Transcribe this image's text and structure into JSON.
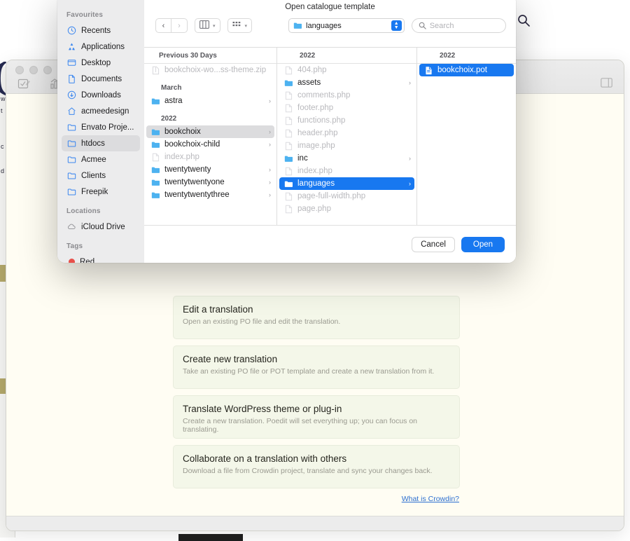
{
  "desktop": {
    "search_icon": "search-icon",
    "sliver_text": "w\nt\n\nc\n\nd"
  },
  "poedit_window": {
    "toolbar": {
      "traffic_lights": [
        "close",
        "minimize",
        "zoom"
      ],
      "icons": [
        "new-translation-icon",
        "statistics-icon"
      ],
      "sidebar_toggle_icon": "sidebar-toggle-icon"
    },
    "welcome": {
      "cards": [
        {
          "title": "Edit a translation",
          "subtitle": "Open an existing PO file and edit the translation."
        },
        {
          "title": "Create new translation",
          "subtitle": "Take an existing PO file or POT template and create a new translation from it."
        },
        {
          "title": "Translate WordPress theme or plug-in",
          "subtitle": "Create a new translation. Poedit will set everything up; you can focus on translating."
        },
        {
          "title": "Collaborate on a translation with others",
          "subtitle": "Download a file from Crowdin project, translate and sync your changes back."
        }
      ],
      "crowdin_link": "What is Crowdin?"
    }
  },
  "dialog": {
    "title": "Open catalogue template",
    "toolbar": {
      "back_label": "‹",
      "forward_label": "›",
      "view_icon": "column-view-icon",
      "view_chevron": "▾",
      "group_icon": "grid-view-icon",
      "group_chevron": "▾",
      "path_value": "languages",
      "path_icon": "folder-icon",
      "stepper_icon": "stepper-updown-icon",
      "search_icon": "search-icon",
      "search_value": "",
      "search_placeholder": "Search"
    },
    "sidebar": {
      "sections": [
        {
          "header": "Favourites",
          "items": [
            {
              "label": "Recents",
              "icon": "clock-icon",
              "selected": false
            },
            {
              "label": "Applications",
              "icon": "applications-icon",
              "selected": false
            },
            {
              "label": "Desktop",
              "icon": "desktop-icon",
              "selected": false
            },
            {
              "label": "Documents",
              "icon": "document-icon",
              "selected": false
            },
            {
              "label": "Downloads",
              "icon": "download-icon",
              "selected": false
            },
            {
              "label": "acmeedesign",
              "icon": "home-icon",
              "selected": false
            },
            {
              "label": "Envato Proje...",
              "icon": "folder-icon",
              "selected": false
            },
            {
              "label": "htdocs",
              "icon": "folder-icon",
              "selected": true
            },
            {
              "label": "Acmee",
              "icon": "folder-icon",
              "selected": false
            },
            {
              "label": "Clients",
              "icon": "folder-icon",
              "selected": false
            },
            {
              "label": "Freepik",
              "icon": "folder-icon",
              "selected": false
            }
          ]
        },
        {
          "header": "Locations",
          "items": [
            {
              "label": "iCloud Drive",
              "icon": "cloud-icon",
              "selected": false
            }
          ]
        },
        {
          "header": "Tags",
          "items": [
            {
              "label": "Red",
              "icon": "tag-red-icon",
              "selected": false
            }
          ]
        }
      ]
    },
    "columns": [
      {
        "header": "Previous 30 Days",
        "rows": [
          {
            "label": "bookchoix-wo...ss-theme.zip",
            "icon": "archive-icon",
            "kind": "file",
            "state": "dimmed",
            "chevron": false
          },
          {
            "label": "March",
            "kind": "group",
            "state": "normal",
            "chevron": false
          },
          {
            "label": "astra",
            "icon": "folder-icon",
            "kind": "folder",
            "state": "normal",
            "chevron": true
          },
          {
            "label": "2022",
            "kind": "group",
            "state": "normal",
            "chevron": false
          },
          {
            "label": "bookchoix",
            "icon": "folder-icon",
            "kind": "folder",
            "state": "selected-grey",
            "chevron": true
          },
          {
            "label": "bookchoix-child",
            "icon": "folder-icon",
            "kind": "folder",
            "state": "normal",
            "chevron": true
          },
          {
            "label": "index.php",
            "icon": "php-file-icon",
            "kind": "file",
            "state": "dimmed",
            "chevron": false
          },
          {
            "label": "twentytwenty",
            "icon": "folder-icon",
            "kind": "folder",
            "state": "normal",
            "chevron": true
          },
          {
            "label": "twentytwentyone",
            "icon": "folder-icon",
            "kind": "folder",
            "state": "normal",
            "chevron": true
          },
          {
            "label": "twentytwentythree",
            "icon": "folder-icon",
            "kind": "folder",
            "state": "normal",
            "chevron": true
          }
        ]
      },
      {
        "header": "2022",
        "rows": [
          {
            "label": "404.php",
            "icon": "php-file-icon",
            "kind": "file",
            "state": "dimmed",
            "chevron": false
          },
          {
            "label": "assets",
            "icon": "folder-icon",
            "kind": "folder",
            "state": "normal",
            "chevron": true
          },
          {
            "label": "comments.php",
            "icon": "php-file-icon",
            "kind": "file",
            "state": "dimmed",
            "chevron": false
          },
          {
            "label": "footer.php",
            "icon": "php-file-icon",
            "kind": "file",
            "state": "dimmed",
            "chevron": false
          },
          {
            "label": "functions.php",
            "icon": "php-file-icon",
            "kind": "file",
            "state": "dimmed",
            "chevron": false
          },
          {
            "label": "header.php",
            "icon": "php-file-icon",
            "kind": "file",
            "state": "dimmed",
            "chevron": false
          },
          {
            "label": "image.php",
            "icon": "php-file-icon",
            "kind": "file",
            "state": "dimmed",
            "chevron": false
          },
          {
            "label": "inc",
            "icon": "folder-icon",
            "kind": "folder",
            "state": "normal",
            "chevron": true
          },
          {
            "label": "index.php",
            "icon": "php-file-icon",
            "kind": "file",
            "state": "dimmed",
            "chevron": false
          },
          {
            "label": "languages",
            "icon": "folder-icon",
            "kind": "folder",
            "state": "selected-blue",
            "chevron": true
          },
          {
            "label": "page-full-width.php",
            "icon": "php-file-icon",
            "kind": "file",
            "state": "dimmed",
            "chevron": false
          },
          {
            "label": "page.php",
            "icon": "php-file-icon",
            "kind": "file",
            "state": "dimmed",
            "chevron": false
          }
        ]
      },
      {
        "header": "2022",
        "rows": [
          {
            "label": "bookchoix.pot",
            "icon": "pot-file-icon",
            "kind": "file",
            "state": "selected-blue",
            "chevron": false
          }
        ]
      }
    ],
    "footer": {
      "cancel_label": "Cancel",
      "open_label": "Open"
    }
  },
  "colors": {
    "accent_blue": "#1878f0",
    "folder_blue": "#4db2f0",
    "sidebar_icon_blue": "#3c87ef",
    "selection_grey": "#dcdcde",
    "poedit_card_bg": "#f4f7e9",
    "poedit_bg": "#fffdf3",
    "tag_red": "#e8504a"
  }
}
